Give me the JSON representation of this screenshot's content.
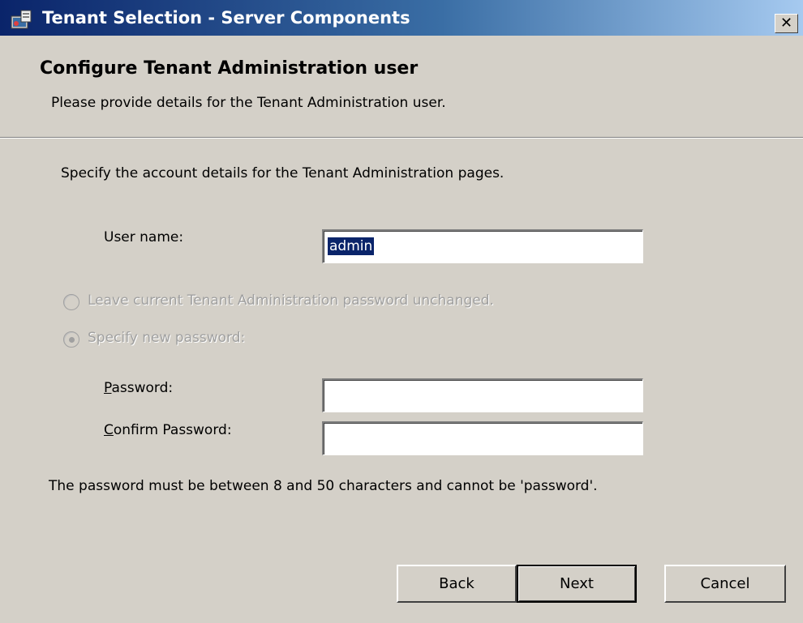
{
  "window": {
    "title": "Tenant Selection - Server Components",
    "close_label": "✕"
  },
  "header": {
    "title": "Configure Tenant Administration user",
    "subtitle": "Please provide details for the Tenant Administration user."
  },
  "form": {
    "intro": "Specify the account details for the Tenant Administration pages.",
    "username_label": "User name:",
    "username_value": "admin",
    "radio_leave_label": "Leave current Tenant Administration password unchanged.",
    "radio_specify_label": "Specify new password:",
    "password_label_mnemonic": "P",
    "password_label_rest": "assword:",
    "confirm_label_mnemonic": "C",
    "confirm_label_rest": "onfirm Password:",
    "password_value": "",
    "confirm_value": "",
    "note": "The password must be between 8 and 50 characters and cannot be 'password'."
  },
  "buttons": {
    "back": "Back",
    "next": "Next",
    "cancel": "Cancel"
  },
  "icons": {
    "app": "installer-icon",
    "close": "close-icon",
    "radio_unselected": "radio-unselected-icon",
    "radio_selected": "radio-selected-icon"
  },
  "colors": {
    "titlebar_start": "#0a246a",
    "titlebar_end": "#a6caf0",
    "dialog_bg": "#d4d0c8",
    "selection": "#0a246a",
    "disabled_text": "#a0a0a0"
  }
}
